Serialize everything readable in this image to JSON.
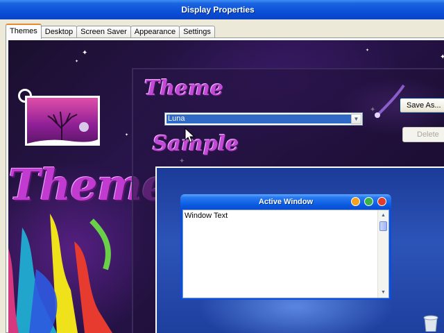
{
  "window": {
    "title": "Display Properties"
  },
  "tabs": [
    {
      "label": "Themes",
      "active": true
    },
    {
      "label": "Desktop",
      "active": false
    },
    {
      "label": "Screen Saver",
      "active": false
    },
    {
      "label": "Appearance",
      "active": false
    },
    {
      "label": "Settings",
      "active": false
    }
  ],
  "artwork": {
    "big_word": "Themes",
    "theme_heading": "Theme",
    "sample_heading": "Sample"
  },
  "theme_select": {
    "value": "Luna"
  },
  "buttons": {
    "save_as": "Save As...",
    "delete": "Delete"
  },
  "preview": {
    "window_title": "Active Window",
    "window_text": "Window Text"
  },
  "colors": {
    "accent": "#316ac5",
    "titlebar": "#0a50d8",
    "theme_purple": "#c13bd0"
  }
}
